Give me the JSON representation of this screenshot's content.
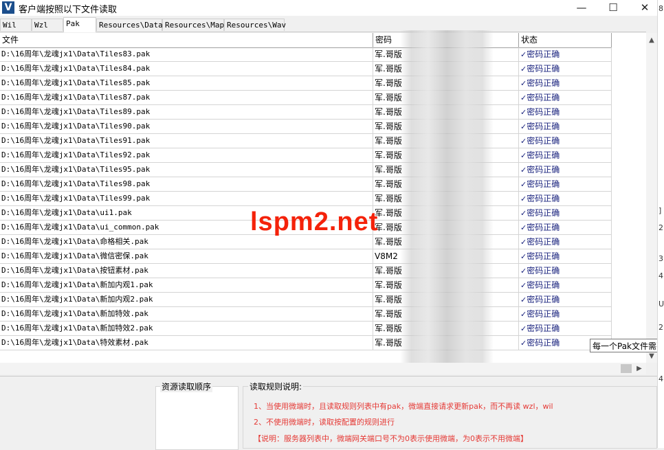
{
  "window": {
    "icon_letter": "V",
    "title": "客户端按照以下文件读取",
    "minimize": "—",
    "maximize": "☐",
    "close": "✕"
  },
  "tabs": [
    "Wil",
    "Wzl",
    "Pak",
    "Resources\\Data",
    "Resources\\Map",
    "Resources\\Wav"
  ],
  "active_tab": "Pak",
  "table": {
    "headers": {
      "file": "文件",
      "password": "密码",
      "status": "状态"
    },
    "rows": [
      {
        "file": "D:\\16周年\\龙魂jx1\\Data\\Tiles83.pak",
        "password": "军.哥版",
        "status": "密码正确"
      },
      {
        "file": "D:\\16周年\\龙魂jx1\\Data\\Tiles84.pak",
        "password": "军.哥版",
        "status": "密码正确"
      },
      {
        "file": "D:\\16周年\\龙魂jx1\\Data\\Tiles85.pak",
        "password": "军.哥版",
        "status": "密码正确"
      },
      {
        "file": "D:\\16周年\\龙魂jx1\\Data\\Tiles87.pak",
        "password": "军.哥版",
        "status": "密码正确"
      },
      {
        "file": "D:\\16周年\\龙魂jx1\\Data\\Tiles89.pak",
        "password": "军.哥版",
        "status": "密码正确"
      },
      {
        "file": "D:\\16周年\\龙魂jx1\\Data\\Tiles90.pak",
        "password": "军.哥版",
        "status": "密码正确"
      },
      {
        "file": "D:\\16周年\\龙魂jx1\\Data\\Tiles91.pak",
        "password": "军.哥版",
        "status": "密码正确"
      },
      {
        "file": "D:\\16周年\\龙魂jx1\\Data\\Tiles92.pak",
        "password": "军.哥版",
        "status": "密码正确"
      },
      {
        "file": "D:\\16周年\\龙魂jx1\\Data\\Tiles95.pak",
        "password": "军.哥版",
        "status": "密码正确"
      },
      {
        "file": "D:\\16周年\\龙魂jx1\\Data\\Tiles98.pak",
        "password": "军.哥版",
        "status": "密码正确"
      },
      {
        "file": "D:\\16周年\\龙魂jx1\\Data\\Tiles99.pak",
        "password": "军.哥版",
        "status": "密码正确"
      },
      {
        "file": "D:\\16周年\\龙魂jx1\\Data\\ui1.pak",
        "password": "军.哥版",
        "status": "密码正确"
      },
      {
        "file": "D:\\16周年\\龙魂jx1\\Data\\ui_common.pak",
        "password": "军.哥版",
        "status": "密码正确"
      },
      {
        "file": "D:\\16周年\\龙魂jx1\\Data\\命格相关.pak",
        "password": "军.哥版",
        "status": "密码正确"
      },
      {
        "file": "D:\\16周年\\龙魂jx1\\Data\\微信密保.pak",
        "password": "V8M2",
        "status": "密码正确"
      },
      {
        "file": "D:\\16周年\\龙魂jx1\\Data\\按钮素材.pak",
        "password": "军.哥版",
        "status": "密码正确"
      },
      {
        "file": "D:\\16周年\\龙魂jx1\\Data\\新加内观1.pak",
        "password": "军.哥版",
        "status": "密码正确"
      },
      {
        "file": "D:\\16周年\\龙魂jx1\\Data\\新加内观2.pak",
        "password": "军.哥版",
        "status": "密码正确"
      },
      {
        "file": "D:\\16周年\\龙魂jx1\\Data\\新加特效.pak",
        "password": "军.哥版",
        "status": "密码正确"
      },
      {
        "file": "D:\\16周年\\龙魂jx1\\Data\\新加特效2.pak",
        "password": "军.哥版",
        "status": "密码正确"
      },
      {
        "file": "D:\\16周年\\龙魂jx1\\Data\\特效素材.pak",
        "password": "军.哥版",
        "status": "密码正确"
      }
    ]
  },
  "watermark": "lspm2.net",
  "tooltip": "每一个Pak文件需要",
  "bottom": {
    "order_label": "资源读取顺序",
    "rules_label": "读取规则说明:",
    "rules": [
      "1、当使用微端时，且读取规则列表中有pak，微端直接请求更新pak，而不再读 wzl，wil",
      "2、不使用微端时，读取按配置的规则进行",
      "【说明：服务器列表中，微端网关端口号不为0表示使用微端，为0表示不用微端】"
    ]
  },
  "right_edge_chars": [
    "8",
    "]",
    "2",
    "3",
    "4",
    "U",
    "2",
    "4"
  ]
}
